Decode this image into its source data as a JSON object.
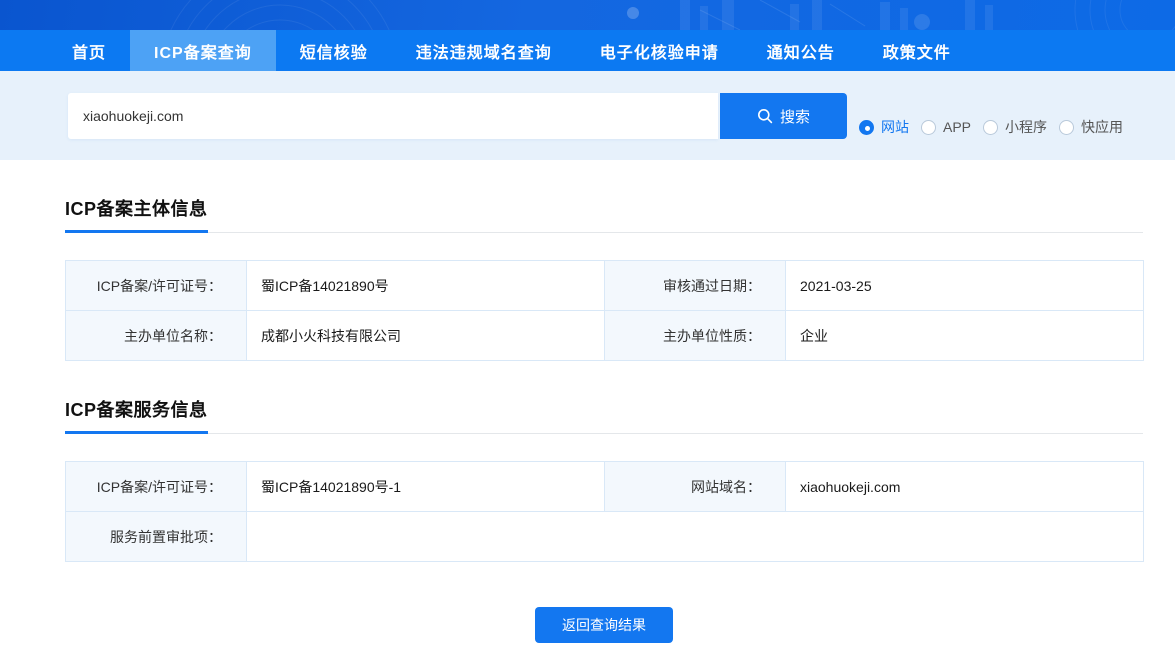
{
  "nav": {
    "items": [
      {
        "label": "首页",
        "active": false
      },
      {
        "label": "ICP备案查询",
        "active": true
      },
      {
        "label": "短信核验",
        "active": false
      },
      {
        "label": "违法违规域名查询",
        "active": false
      },
      {
        "label": "电子化核验申请",
        "active": false
      },
      {
        "label": "通知公告",
        "active": false
      },
      {
        "label": "政策文件",
        "active": false
      }
    ]
  },
  "search": {
    "input_value": "xiaohuokeji.com",
    "button_label": "搜索",
    "types": [
      {
        "label": "网站",
        "selected": true
      },
      {
        "label": "APP",
        "selected": false
      },
      {
        "label": "小程序",
        "selected": false
      },
      {
        "label": "快应用",
        "selected": false
      }
    ]
  },
  "subject": {
    "title": "ICP备案主体信息",
    "rows": [
      {
        "l1": "ICP备案/许可证号：",
        "v1": "蜀ICP备14021890号",
        "l2": "审核通过日期：",
        "v2": "2021-03-25"
      },
      {
        "l1": "主办单位名称：",
        "v1": "成都小火科技有限公司",
        "l2": "主办单位性质：",
        "v2": "企业"
      }
    ]
  },
  "service": {
    "title": "ICP备案服务信息",
    "rows": [
      {
        "l1": "ICP备案/许可证号：",
        "v1": "蜀ICP备14021890号-1",
        "l2": "网站域名：",
        "v2": "xiaohuokeji.com"
      },
      {
        "l1": "服务前置审批项：",
        "v1": ""
      }
    ]
  },
  "back_button": {
    "label": "返回查询结果"
  },
  "colors": {
    "accent": "#1377f0",
    "nav_bar": "#0c79f2",
    "active_tab": "#4da2f5",
    "banner": "#0d63dd",
    "search_bg": "#e7f1fb",
    "label_cell_bg": "#f3f8fd",
    "table_border": "#d9e8f7"
  }
}
